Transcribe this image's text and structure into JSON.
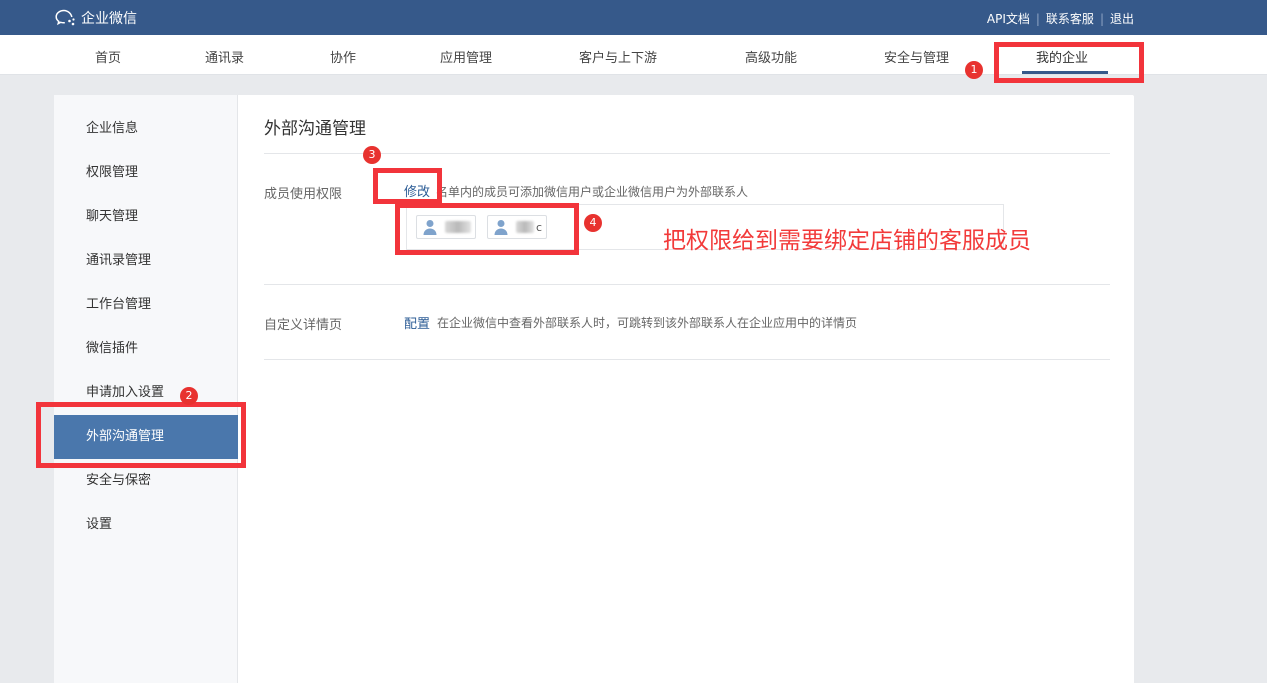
{
  "topbar": {
    "logo_text": "企业微信",
    "links": [
      "API文档",
      "联系客服",
      "退出"
    ]
  },
  "nav": {
    "items": [
      "首页",
      "通讯录",
      "协作",
      "应用管理",
      "客户与上下游",
      "高级功能",
      "安全与管理",
      "我的企业"
    ],
    "active": "我的企业"
  },
  "sidebar": {
    "items": [
      "企业信息",
      "权限管理",
      "聊天管理",
      "通讯录管理",
      "工作台管理",
      "微信插件",
      "申请加入设置",
      "外部沟通管理",
      "安全与保密",
      "设置"
    ],
    "active": "外部沟通管理"
  },
  "main": {
    "title": "外部沟通管理",
    "member_permission": {
      "label": "成员使用权限",
      "action": "修改",
      "desc": "名单内的成员可添加微信用户或企业微信用户为外部联系人",
      "members": [
        "",
        "c"
      ]
    },
    "custom_detail": {
      "label": "自定义详情页",
      "action": "配置",
      "desc": "在企业微信中查看外部联系人时，可跳转到该外部联系人在企业应用中的详情页"
    }
  },
  "annotations": {
    "badges": [
      "1",
      "2",
      "3",
      "4"
    ],
    "text": "把权限给到需要绑定店铺的客服成员",
    "color": "#f2343b"
  },
  "colors": {
    "topbar": "#36598a",
    "active_sidebar": "#4a77ac",
    "link": "#2d5d96"
  }
}
